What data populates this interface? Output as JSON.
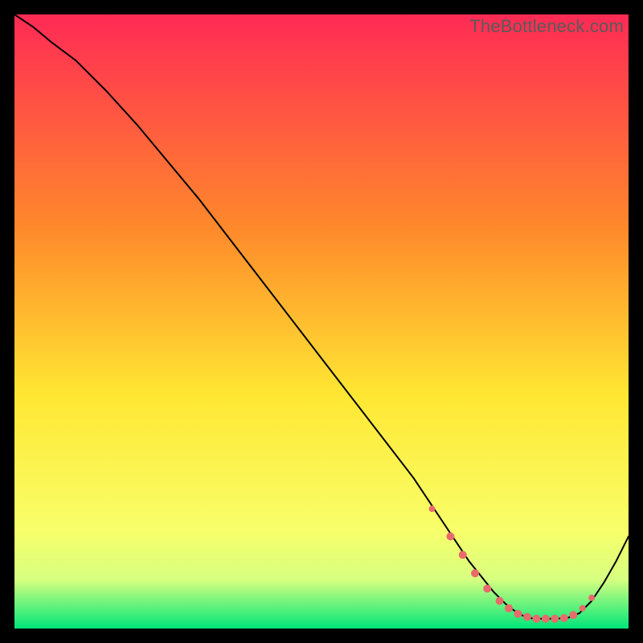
{
  "watermark": "TheBottleneck.com",
  "colors": {
    "gradient_top": "#ff2a55",
    "gradient_mid1": "#ff8a2b",
    "gradient_mid2": "#ffe733",
    "gradient_mid3": "#f8ff6a",
    "gradient_bottom": "#00e67a",
    "curve": "#000000",
    "markers": "#e86b6b",
    "background": "#000000"
  },
  "chart_data": {
    "type": "line",
    "title": "",
    "xlabel": "",
    "ylabel": "",
    "xlim": [
      0,
      100
    ],
    "ylim": [
      0,
      100
    ],
    "series": [
      {
        "name": "bottleneck-curve",
        "x": [
          0,
          3,
          6,
          10,
          15,
          20,
          25,
          30,
          35,
          40,
          45,
          50,
          55,
          60,
          65,
          68,
          70,
          72,
          74,
          76,
          78,
          80,
          81,
          82,
          83,
          84,
          85,
          86,
          88,
          90,
          92,
          94,
          96,
          98,
          100
        ],
        "y": [
          100,
          98,
          95.5,
          92.5,
          87.5,
          82,
          76,
          70,
          63.5,
          57,
          50.5,
          44,
          37.5,
          31,
          24.5,
          20,
          17,
          14,
          11,
          8.5,
          6,
          4,
          3.2,
          2.5,
          2,
          1.7,
          1.6,
          1.6,
          1.6,
          1.7,
          2.5,
          4.5,
          7.5,
          11,
          15
        ]
      }
    ],
    "markers": {
      "name": "highlight-dots",
      "color": "#e86b6b",
      "points": [
        {
          "x": 68,
          "y": 19.5,
          "r": 4
        },
        {
          "x": 71,
          "y": 15,
          "r": 5
        },
        {
          "x": 73,
          "y": 12,
          "r": 5
        },
        {
          "x": 75,
          "y": 9,
          "r": 5
        },
        {
          "x": 77,
          "y": 6.5,
          "r": 5
        },
        {
          "x": 79,
          "y": 4.5,
          "r": 5
        },
        {
          "x": 80.5,
          "y": 3.3,
          "r": 5
        },
        {
          "x": 82,
          "y": 2.4,
          "r": 5
        },
        {
          "x": 83.5,
          "y": 1.9,
          "r": 5
        },
        {
          "x": 85,
          "y": 1.6,
          "r": 5
        },
        {
          "x": 86.5,
          "y": 1.6,
          "r": 5
        },
        {
          "x": 88,
          "y": 1.6,
          "r": 5
        },
        {
          "x": 89.5,
          "y": 1.7,
          "r": 5
        },
        {
          "x": 91,
          "y": 2.2,
          "r": 5
        },
        {
          "x": 92.5,
          "y": 3.3,
          "r": 4
        },
        {
          "x": 94,
          "y": 5,
          "r": 4
        }
      ]
    }
  }
}
